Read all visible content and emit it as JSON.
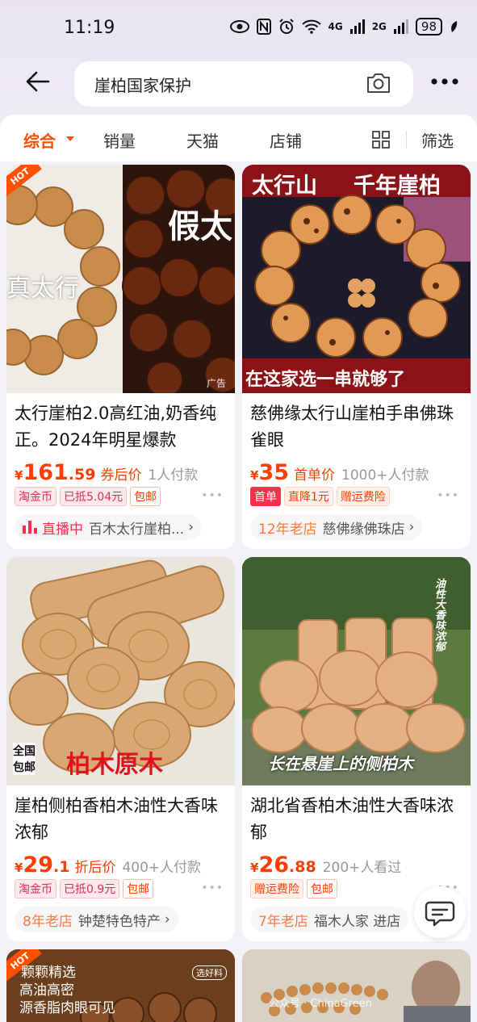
{
  "status_bar": {
    "time": "11:19",
    "network_4g": "4G",
    "network_2g": "2G",
    "battery": "98"
  },
  "search": {
    "query": "崖柏国家保护"
  },
  "filters": {
    "tabs": [
      "综合",
      "销量",
      "天猫",
      "店铺"
    ],
    "filter_label": "筛选",
    "active": "综合"
  },
  "accent_color": "#ff5000",
  "products": [
    {
      "image_texts": [
        "HOT",
        "真太行",
        "假太",
        "广告"
      ],
      "title": "太行崖柏2.0高红油,奶香纯正。2024年明星爆款",
      "currency": "¥",
      "price_int": "161",
      "price_dec": ".59",
      "price_tag": "券后价",
      "sold": "1人付款",
      "badges": [
        "淘金币",
        "已抵5.04元",
        "包邮"
      ],
      "shop_highlight": "直播中",
      "shop_name": "百木太行崖柏..."
    },
    {
      "image_texts": [
        "太行山",
        "千年崖柏",
        "在这家选一串就够了"
      ],
      "title": "慈佛缘太行山崖柏手串佛珠雀眼",
      "currency": "¥",
      "price_int": "35",
      "price_dec": "",
      "price_tag": "首单价",
      "sold": "1000+人付款",
      "badges": [
        "首单",
        "直降1元",
        "赠运费险"
      ],
      "shop_years": "12年老店",
      "shop_name": "慈佛缘佛珠店"
    },
    {
      "image_texts": [
        "全国",
        "包邮",
        "柏木原木"
      ],
      "title": "崖柏侧柏香柏木油性大香味浓郁",
      "currency": "¥",
      "price_int": "29",
      "price_dec": ".1",
      "price_tag": "折后价",
      "sold": "400+人付款",
      "badges": [
        "淘金币",
        "已抵0.9元",
        "包邮"
      ],
      "shop_years": "8年老店",
      "shop_name": "钟楚特色特产"
    },
    {
      "image_texts": [
        "油性大香味浓郁",
        "长在悬崖上的侧柏木"
      ],
      "title": "湖北省香柏木油性大香味浓郁",
      "currency": "¥",
      "price_int": "26",
      "price_dec": ".88",
      "price_tag": "",
      "sold": "200+人看过",
      "badges": [
        "赠运费险",
        "包邮"
      ],
      "shop_years": "7年老店",
      "shop_name": "福木人家 进店"
    },
    {
      "image_texts": [
        "HOT",
        "颗颗精选",
        "高油高密",
        "源香脂肉眼可见",
        "选好料"
      ]
    },
    {
      "image_texts": []
    }
  ],
  "watermark": "公众号 · ChinaGreen"
}
